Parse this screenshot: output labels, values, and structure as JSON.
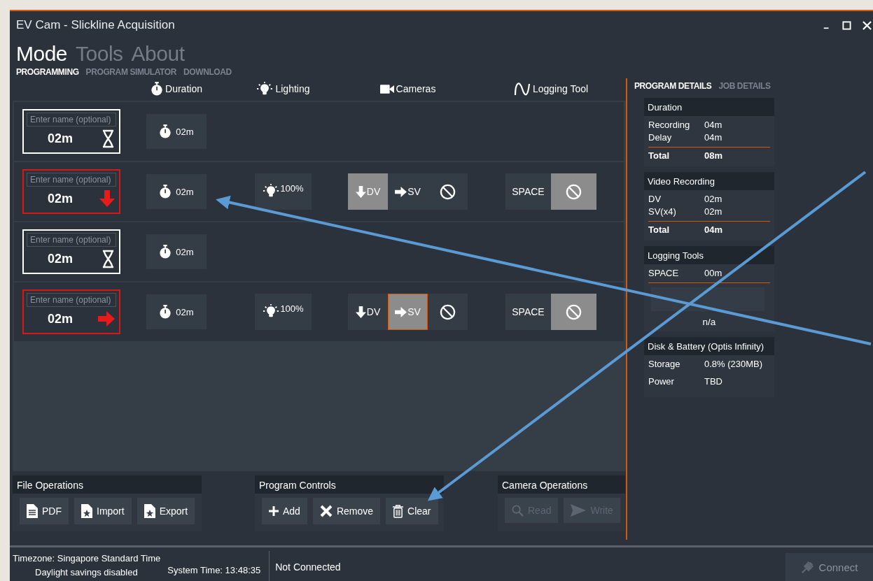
{
  "window": {
    "title": "EV Cam - Slickline Acquisition"
  },
  "main_tabs": [
    {
      "label": "Mode",
      "selected": true
    },
    {
      "label": "Tools",
      "selected": false
    },
    {
      "label": "About",
      "selected": false
    }
  ],
  "sub_tabs": [
    {
      "label": "PROGRAMMING",
      "selected": true
    },
    {
      "label": "PROGRAM SIMULATOR",
      "selected": false
    },
    {
      "label": "DOWNLOAD",
      "selected": false
    }
  ],
  "columns": [
    {
      "label": "Duration"
    },
    {
      "label": "Lighting"
    },
    {
      "label": "Cameras"
    },
    {
      "label": "Logging Tool"
    }
  ],
  "rows": [
    {
      "kind": "delay",
      "placeholder": "Enter name (optional)",
      "time": "02m",
      "duration": "02m"
    },
    {
      "kind": "down_view",
      "placeholder": "Enter name (optional)",
      "time": "02m",
      "duration": "02m",
      "lighting": "100%",
      "cameras": [
        {
          "kind": "dv",
          "label": "DV",
          "selected": true,
          "focused": false
        },
        {
          "kind": "sv",
          "label": "SV",
          "selected": false,
          "focused": false
        },
        {
          "kind": "none",
          "selected": false,
          "focused": false
        }
      ],
      "logging": [
        {
          "kind": "label",
          "label": "SPACE",
          "selected": false
        },
        {
          "kind": "none",
          "selected": true
        }
      ]
    },
    {
      "kind": "delay",
      "placeholder": "Enter name (optional)",
      "time": "02m",
      "duration": "02m"
    },
    {
      "kind": "side_view",
      "placeholder": "Enter name (optional)",
      "time": "02m",
      "duration": "02m",
      "lighting": "100%",
      "cameras": [
        {
          "kind": "dv",
          "label": "DV",
          "selected": false,
          "focused": false
        },
        {
          "kind": "sv",
          "label": "SV",
          "selected": true,
          "focused": true
        },
        {
          "kind": "none",
          "selected": false,
          "focused": false
        }
      ],
      "logging": [
        {
          "kind": "label",
          "label": "SPACE",
          "selected": false
        },
        {
          "kind": "none",
          "selected": true
        }
      ]
    }
  ],
  "details_tabs": [
    {
      "label": "PROGRAM DETAILS",
      "selected": true
    },
    {
      "label": "JOB DETAILS",
      "selected": false
    }
  ],
  "details": [
    {
      "title": "Duration",
      "lines": [
        {
          "label": "Recording",
          "value": "04m"
        },
        {
          "label": "Delay",
          "value": "04m"
        }
      ],
      "total": {
        "label": "Total",
        "value": "08m"
      }
    },
    {
      "title": "Video Recording",
      "lines": [
        {
          "label": "DV",
          "value": "02m"
        },
        {
          "label": "SV(x4)",
          "value": "02m"
        }
      ],
      "total": {
        "label": "Total",
        "value": "04m"
      }
    },
    {
      "title": "Logging Tools",
      "lines": [
        {
          "label": "SPACE",
          "value": "00m"
        }
      ],
      "button": {
        "disabled": true
      },
      "note": "n/a"
    },
    {
      "title": "Disk & Battery (Optis Infinity)",
      "lines": [
        {
          "label": "Storage",
          "value": "0.8%  (230MB)"
        },
        {
          "label": "Power",
          "value": "TBD"
        }
      ]
    }
  ],
  "groups": [
    {
      "title": "File Operations",
      "buttons": [
        {
          "kind": "pdf",
          "label": "PDF",
          "disabled": false
        },
        {
          "kind": "import",
          "label": "Import",
          "disabled": false
        },
        {
          "kind": "export",
          "label": "Export",
          "disabled": false
        }
      ]
    },
    {
      "title": "Program Controls",
      "buttons": [
        {
          "kind": "add",
          "label": "Add",
          "disabled": false
        },
        {
          "kind": "remove",
          "label": "Remove",
          "disabled": false
        },
        {
          "kind": "clear",
          "label": "Clear",
          "disabled": false
        }
      ]
    },
    {
      "title": "Camera Operations",
      "buttons": [
        {
          "kind": "read",
          "label": "Read",
          "disabled": true
        },
        {
          "kind": "write",
          "label": "Write",
          "disabled": true
        }
      ]
    }
  ],
  "status_bar": {
    "timezone": "Timezone: Singapore Standard Time",
    "daylight": "Daylight savings disabled",
    "system_time": "System Time: 13:48:35",
    "connection": "Not Connected",
    "connect_button": {
      "label": "Connect",
      "disabled": true
    }
  }
}
